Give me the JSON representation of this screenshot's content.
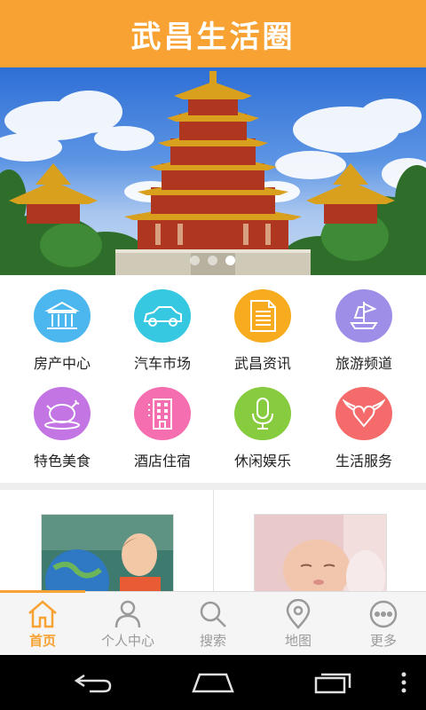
{
  "header": {
    "title": "武昌生活圈"
  },
  "banner": {
    "image": "yellow-crane-tower-photo",
    "slides": 3,
    "active_slide": 2
  },
  "categories": [
    {
      "label": "房产中心",
      "icon": "building-icon",
      "color": "#4cb7ee"
    },
    {
      "label": "汽车市场",
      "icon": "car-icon",
      "color": "#35c8e0"
    },
    {
      "label": "武昌资讯",
      "icon": "document-icon",
      "color": "#f7ab1f"
    },
    {
      "label": "旅游频道",
      "icon": "sailboat-icon",
      "color": "#9f8ee8"
    },
    {
      "label": "特色美食",
      "icon": "roast-chicken-icon",
      "color": "#c475e4"
    },
    {
      "label": "酒店住宿",
      "icon": "hotel-icon",
      "color": "#f56fb0"
    },
    {
      "label": "休闲娱乐",
      "icon": "microphone-icon",
      "color": "#86cc3e"
    },
    {
      "label": "生活服务",
      "icon": "winged-heart-icon",
      "color": "#f56a6a"
    }
  ],
  "cards": [
    {
      "image": "boy-with-globe-photo"
    },
    {
      "image": "sleeping-baby-photo"
    }
  ],
  "tabs": [
    {
      "label": "首页",
      "icon": "home-icon",
      "active": true
    },
    {
      "label": "个人中心",
      "icon": "person-icon",
      "active": false
    },
    {
      "label": "搜索",
      "icon": "search-icon",
      "active": false
    },
    {
      "label": "地图",
      "icon": "map-pin-icon",
      "active": false
    },
    {
      "label": "更多",
      "icon": "more-icon",
      "active": false
    }
  ],
  "colors": {
    "accent": "#f7a233",
    "tab_inactive": "#9a9a9a",
    "system_bar": "#000000"
  }
}
